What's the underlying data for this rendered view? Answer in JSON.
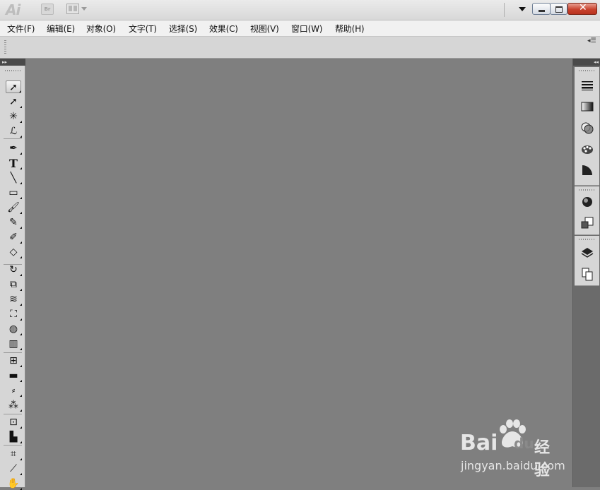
{
  "app": {
    "logo": "Ai",
    "bridge_label": "Br"
  },
  "menu": {
    "items": [
      "文件(F)",
      "编辑(E)",
      "对象(O)",
      "文字(T)",
      "选择(S)",
      "效果(C)",
      "视图(V)",
      "窗口(W)",
      "帮助(H)"
    ]
  },
  "tools": [
    {
      "name": "selection-tool",
      "glyph": "➚",
      "selected": true
    },
    {
      "name": "direct-selection-tool",
      "glyph": "➚"
    },
    {
      "name": "magic-wand-tool",
      "glyph": "✳"
    },
    {
      "name": "lasso-tool",
      "glyph": "ℒ"
    },
    {
      "name": "pen-tool",
      "glyph": "✒"
    },
    {
      "name": "type-tool",
      "glyph": "T"
    },
    {
      "name": "line-segment-tool",
      "glyph": "╲"
    },
    {
      "name": "rectangle-tool",
      "glyph": "▭"
    },
    {
      "name": "paintbrush-tool",
      "glyph": "🖌"
    },
    {
      "name": "pencil-tool",
      "glyph": "✎"
    },
    {
      "name": "blob-brush-tool",
      "glyph": "✐"
    },
    {
      "name": "eraser-tool",
      "glyph": "◇"
    },
    {
      "name": "rotate-tool",
      "glyph": "↻"
    },
    {
      "name": "scale-tool",
      "glyph": "⧉"
    },
    {
      "name": "warp-tool",
      "glyph": "≋"
    },
    {
      "name": "free-transform-tool",
      "glyph": "⛶"
    },
    {
      "name": "shape-builder-tool",
      "glyph": "◍"
    },
    {
      "name": "graph-tool",
      "glyph": "▥"
    },
    {
      "name": "mesh-tool",
      "glyph": "⊞"
    },
    {
      "name": "gradient-tool",
      "glyph": "▬"
    },
    {
      "name": "eyedropper-tool",
      "glyph": "⸗"
    },
    {
      "name": "blend-tool",
      "glyph": "⁂"
    },
    {
      "name": "symbol-sprayer-tool",
      "glyph": "⊡"
    },
    {
      "name": "column-graph-tool",
      "glyph": "▙"
    },
    {
      "name": "artboard-tool",
      "glyph": "⌗"
    },
    {
      "name": "slice-tool",
      "glyph": "⟋"
    },
    {
      "name": "hand-tool",
      "glyph": "✋"
    }
  ],
  "right_panels": [
    {
      "name": "stroke-panel-icon"
    },
    {
      "name": "gradient-panel-icon"
    },
    {
      "name": "transparency-panel-icon"
    },
    {
      "name": "color-panel-icon"
    },
    {
      "name": "color-guide-panel-icon"
    },
    {
      "name": "appearance-panel-icon"
    },
    {
      "name": "graphic-styles-panel-icon"
    },
    {
      "name": "layers-panel-icon"
    },
    {
      "name": "artboards-panel-icon"
    }
  ],
  "watermark": {
    "brand_left": "Bai",
    "brand_du": "du",
    "brand_cn": "经验",
    "url": "jingyan.baidu.com"
  }
}
